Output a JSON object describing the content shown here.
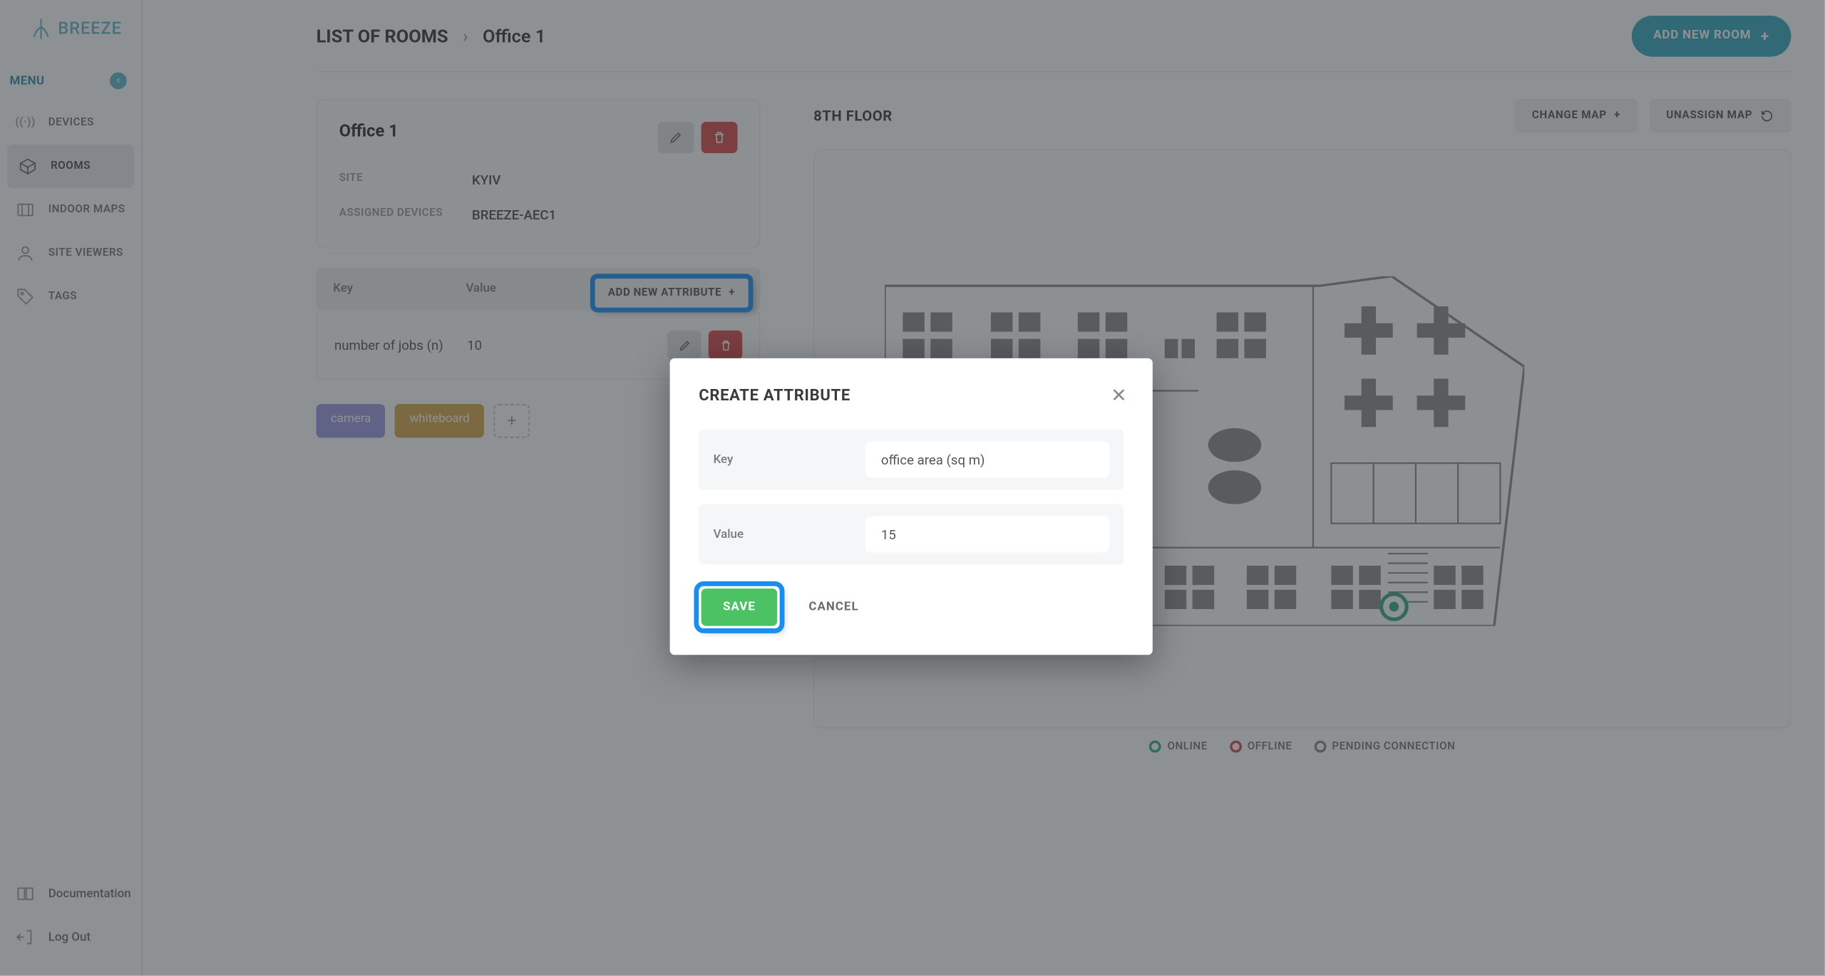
{
  "brand": "BREEZE",
  "sidebar": {
    "menu_label": "MENU",
    "items": [
      {
        "label": "DEVICES"
      },
      {
        "label": "ROOMS"
      },
      {
        "label": "INDOOR MAPS"
      },
      {
        "label": "SITE VIEWERS"
      },
      {
        "label": "TAGS"
      }
    ],
    "bottom": [
      {
        "label": "Documentation"
      },
      {
        "label": "Log Out"
      }
    ]
  },
  "breadcrumb": {
    "root": "LIST OF ROOMS",
    "current": "Office 1"
  },
  "header": {
    "add_room_label": "ADD NEW ROOM"
  },
  "room": {
    "title": "Office 1",
    "site_label": "SITE",
    "site_value": "KYIV",
    "devices_label": "ASSIGNED DEVICES",
    "devices_value": "BREEZE-AEC1"
  },
  "attributes": {
    "header": {
      "key": "Key",
      "value": "Value",
      "add_label": "ADD NEW ATTRIBUTE"
    },
    "rows": [
      {
        "key": "number of jobs (n)",
        "value": "10"
      }
    ]
  },
  "tags": [
    "camera",
    "whiteboard"
  ],
  "map": {
    "title": "8TH FLOOR",
    "change_label": "CHANGE MAP",
    "unassign_label": "UNASSIGN MAP",
    "legend": {
      "online": "ONLINE",
      "offline": "OFFLINE",
      "pending": "PENDING CONNECTION"
    }
  },
  "modal": {
    "title": "CREATE ATTRIBUTE",
    "key_label": "Key",
    "key_value": "office area (sq m)",
    "value_label": "Value",
    "value_value": "15",
    "save_label": "SAVE",
    "cancel_label": "CANCEL"
  }
}
